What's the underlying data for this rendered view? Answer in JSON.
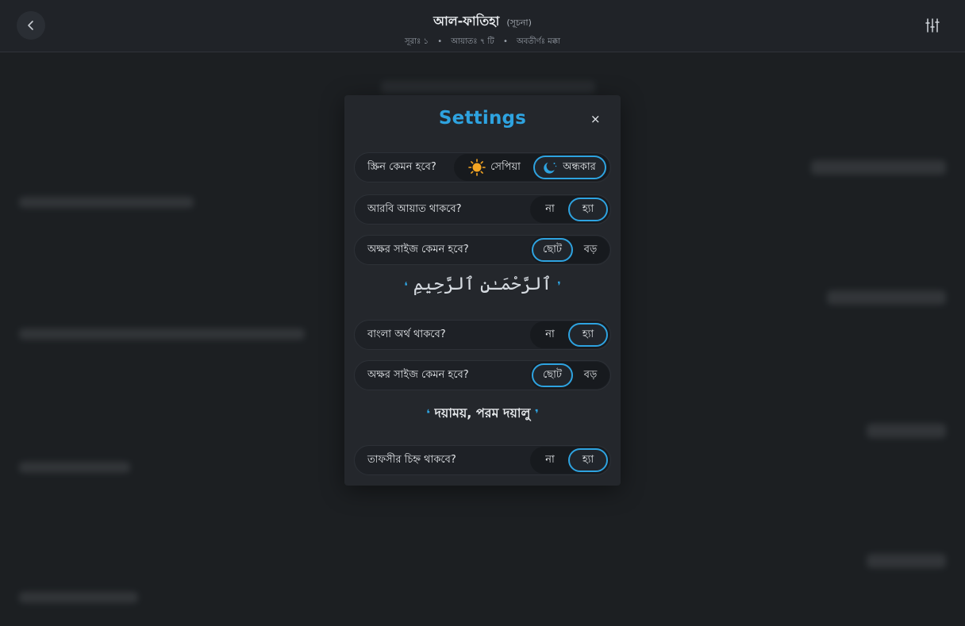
{
  "header": {
    "title": "আল-ফাতিহা",
    "title_tag": "(সূচনা)",
    "meta": [
      "সূরাঃ ১",
      "আয়াতঃ ৭ টি",
      "অবতীর্ণঃ মক্কা"
    ],
    "back_icon": "chevron-left-icon",
    "settings_icon": "sliders-icon"
  },
  "settings": {
    "title": "Settings",
    "close_label": "×",
    "screen": {
      "label": "স্ক্রিন কেমন হবে?",
      "options": [
        "সেপিয়া",
        "অন্ধকার"
      ],
      "selected": "অন্ধকার",
      "icons": [
        "sun-icon",
        "moon-icon"
      ]
    },
    "arabic_ayat": {
      "label": "আরবি আয়াত থাকবে?",
      "options": [
        "না",
        "হ্যা"
      ],
      "selected": "হ্যা"
    },
    "arabic_font_size": {
      "label": "অক্ষর সাইজ কেমন হবে?",
      "options": [
        "ছোট",
        "বড়"
      ],
      "selected": "ছোট"
    },
    "arabic_preview": "ٱلرَّحْمَـٰنِ ٱلرَّحِيمِ",
    "bangla_meaning": {
      "label": "বাংলা অর্থ থাকবে?",
      "options": [
        "না",
        "হ্যা"
      ],
      "selected": "হ্যা"
    },
    "bangla_font_size": {
      "label": "অক্ষর সাইজ কেমন হবে?",
      "options": [
        "ছোট",
        "বড়"
      ],
      "selected": "ছোট"
    },
    "bangla_preview": "দয়াময়, পরম দয়ালু",
    "tafsir_mark": {
      "label": "তাফসীর চিহ্ন থাকবে?",
      "options": [
        "না",
        "হ্যা"
      ],
      "selected": "হ্যা"
    }
  },
  "colors": {
    "accent": "#2ea3e0",
    "background": "#1f2226",
    "modal": "#24272c",
    "sun": "#f5a623"
  }
}
